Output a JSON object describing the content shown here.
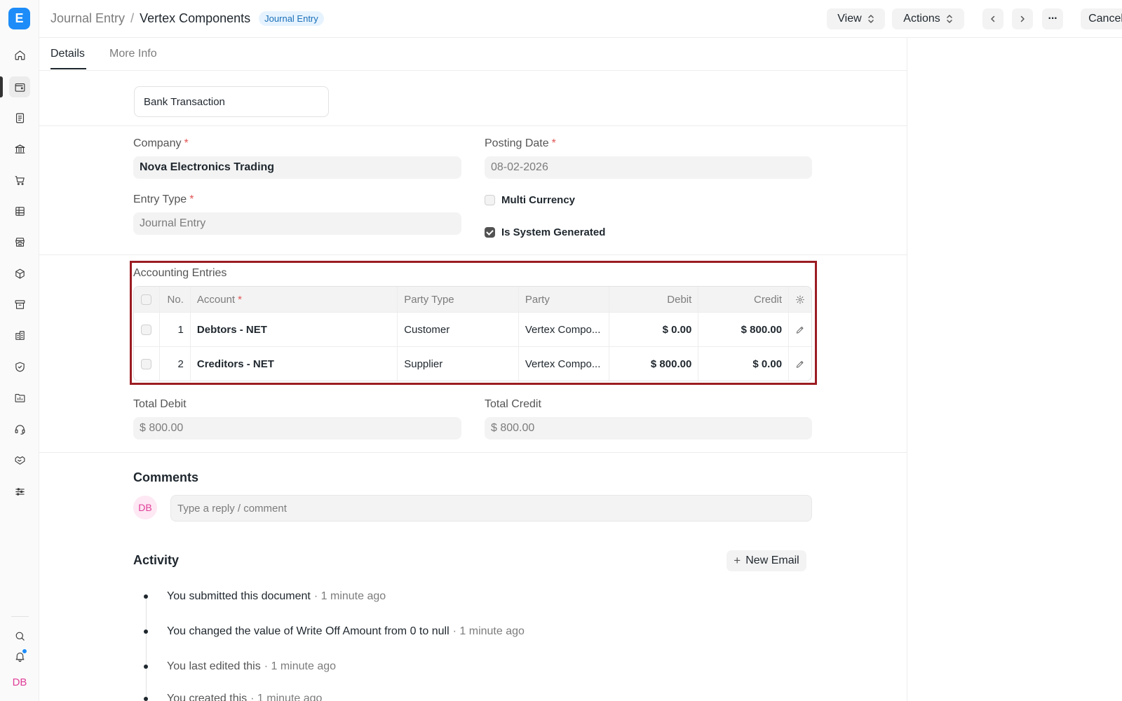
{
  "app": {
    "logo_letter": "E"
  },
  "breadcrumb": {
    "parent": "Journal Entry",
    "separator": "/",
    "current": "Vertex Components",
    "badge": "Journal Entry"
  },
  "header": {
    "view_label": "View",
    "actions_label": "Actions",
    "more_label": "···",
    "cancel_label": "Cancel"
  },
  "tabs": [
    {
      "label": "Details"
    },
    {
      "label": "More Info"
    }
  ],
  "form": {
    "voucher_type_value": "Bank Transaction",
    "company": {
      "label": "Company",
      "required": "*",
      "value": "Nova Electronics Trading"
    },
    "posting_date": {
      "label": "Posting Date",
      "required": "*",
      "value": "08-02-2026"
    },
    "entry_type": {
      "label": "Entry Type",
      "required": "*",
      "value": "Journal Entry"
    },
    "multi_currency": {
      "label": "Multi Currency",
      "checked": false
    },
    "is_system_generated": {
      "label": "Is System Generated",
      "checked": true
    }
  },
  "accounting_entries": {
    "title": "Accounting Entries",
    "columns": {
      "no": "No.",
      "account": "Account",
      "account_required": "*",
      "party_type": "Party Type",
      "party": "Party",
      "debit": "Debit",
      "credit": "Credit"
    },
    "rows": [
      {
        "no": "1",
        "account": "Debtors - NET",
        "party_type": "Customer",
        "party": "Vertex Compo...",
        "debit": "$ 0.00",
        "credit": "$ 800.00"
      },
      {
        "no": "2",
        "account": "Creditors - NET",
        "party_type": "Supplier",
        "party": "Vertex Compo...",
        "debit": "$ 800.00",
        "credit": "$ 0.00"
      }
    ]
  },
  "totals": {
    "debit": {
      "label": "Total Debit",
      "value": "$ 800.00"
    },
    "credit": {
      "label": "Total Credit",
      "value": "$ 800.00"
    }
  },
  "comments": {
    "heading": "Comments",
    "avatar_initials": "DB",
    "placeholder": "Type a reply / comment"
  },
  "activity": {
    "heading": "Activity",
    "new_email_label": "New Email",
    "new_email_icon": "+",
    "items": [
      {
        "text": "You submitted this document",
        "time": "· 1 minute ago"
      },
      {
        "text": "You changed the value of Write Off Amount from 0 to null",
        "time": "· 1 minute ago"
      },
      {
        "text": "You last edited this",
        "time": "· 1 minute ago"
      },
      {
        "text": "You created this",
        "time": "· 1 minute ago"
      }
    ]
  },
  "sidebar": {
    "icons": [
      "home-icon",
      "wallet-icon",
      "file-text-icon",
      "bank-icon",
      "cart-icon",
      "table-icon",
      "store-icon",
      "package-icon",
      "archive-icon",
      "building-icon",
      "shield-icon",
      "folder-icon",
      "headset-icon",
      "handshake-icon",
      "sliders-icon"
    ],
    "bottom_icons": [
      "search-icon",
      "bell-icon"
    ],
    "user_initials": "DB"
  },
  "colors": {
    "accent": "#1d8cf8",
    "highlight_border": "#9b1c22",
    "avatar_pink": "#e03e99",
    "badge_bg": "#e6f3ff",
    "badge_text": "#1a6fb8"
  }
}
